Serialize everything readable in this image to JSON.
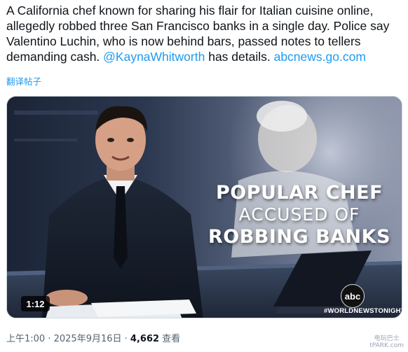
{
  "tweet": {
    "text_before": "A California chef known for sharing his flair for Italian cuisine online, allegedly robbed three San Francisco banks in a single day. Police say Valentino Luchin, who is now behind bars, passed notes to tellers demanding cash. ",
    "mention": "@KaynaWhitworth",
    "text_middle": " has details. ",
    "link": "abcnews.go.com",
    "translate_label": "翻译帖子"
  },
  "video": {
    "headline_line1": "POPULAR CHEF",
    "headline_line2": "ACCUSED OF",
    "headline_line3": "ROBBING BANKS",
    "logo_text": "abc",
    "hashtag": "#WORLDNEWSTONIGHT",
    "duration": "1:12"
  },
  "meta": {
    "time": "上午1:00",
    "separator": " · ",
    "date": "2025年9月16日",
    "views_count": "4,662",
    "views_label": " 查看"
  },
  "watermark": {
    "line1": "电玩巴士",
    "line2": "tPARK.com"
  },
  "colors": {
    "link": "#1d9bf0",
    "text": "#0f1419",
    "muted": "#536471"
  }
}
